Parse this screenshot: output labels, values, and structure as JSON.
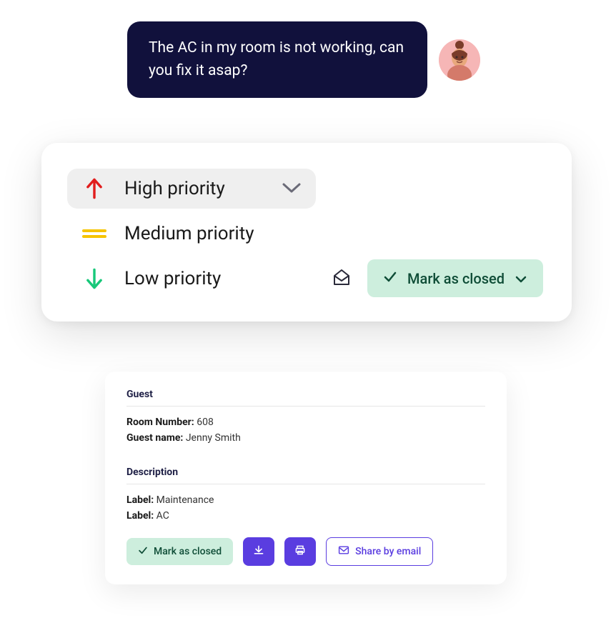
{
  "chat": {
    "message": "The AC in my room is not working, can you fix it asap?"
  },
  "priority": {
    "options": [
      {
        "label": "High priority"
      },
      {
        "label": "Medium priority"
      },
      {
        "label": "Low priority"
      }
    ],
    "mark_closed_label": "Mark as closed"
  },
  "details": {
    "guest_heading": "Guest",
    "room_number_label": "Room Number:",
    "room_number_value": "608",
    "guest_name_label": "Guest name:",
    "guest_name_value": "Jenny Smith",
    "description_heading": "Description",
    "labels": [
      {
        "key": "Label:",
        "value": "Maintenance"
      },
      {
        "key": "Label:",
        "value": "AC"
      }
    ]
  },
  "actions": {
    "mark_closed": "Mark as closed",
    "share_email": "Share by email"
  }
}
